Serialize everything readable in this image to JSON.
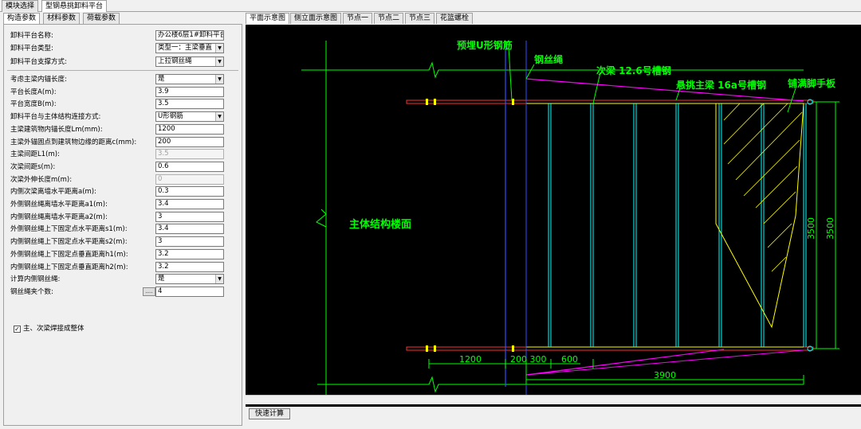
{
  "top_tabs": [
    "模块选择",
    "型钢悬挑卸料平台"
  ],
  "sub_tabs": [
    "构造参数",
    "材料参数",
    "荷载参数"
  ],
  "form": {
    "platform_name_label": "卸料平台名称:",
    "platform_name_value": "办公楼6层1#卸料平台",
    "platform_type_label": "卸料平台类型:",
    "platform_type_value": "类型一：主梁垂直",
    "support_label": "卸料平台支撑方式:",
    "support_value": "上拉钢丝绳",
    "rows": [
      {
        "label": "考虑主梁内锚长度:",
        "value": "是",
        "kind": "select"
      },
      {
        "label": "平台长度A(m):",
        "value": "3.9",
        "kind": "input"
      },
      {
        "label": "平台宽度B(m):",
        "value": "3.5",
        "kind": "input"
      },
      {
        "label": "卸料平台与主体结构连接方式:",
        "value": "U形钢筋",
        "kind": "select"
      },
      {
        "label": "主梁建筑物内锚长度Lm(mm):",
        "value": "1200",
        "kind": "input"
      },
      {
        "label": "主梁外锚固点到建筑物边缘的距离c(mm):",
        "value": "200",
        "kind": "input"
      },
      {
        "label": "主梁间距L1(m):",
        "value": "3.5",
        "kind": "disabled"
      },
      {
        "label": "次梁间距s(m):",
        "value": "0.6",
        "kind": "input"
      },
      {
        "label": "次梁外伸长度m(m):",
        "value": "0",
        "kind": "disabled"
      },
      {
        "label": "内侧次梁离墙水平距离a(m):",
        "value": "0.3",
        "kind": "input"
      },
      {
        "label": "外侧钢丝绳离墙水平距离a1(m):",
        "value": "3.4",
        "kind": "input"
      },
      {
        "label": "内侧钢丝绳离墙水平距离a2(m):",
        "value": "3",
        "kind": "input"
      },
      {
        "label": "外侧钢丝绳上下固定点水平距离s1(m):",
        "value": "3.4",
        "kind": "input"
      },
      {
        "label": "内侧钢丝绳上下固定点水平距离s2(m):",
        "value": "3",
        "kind": "input"
      },
      {
        "label": "外侧钢丝绳上下固定点垂直距离h1(m):",
        "value": "3.2",
        "kind": "input"
      },
      {
        "label": "内侧钢丝绳上下固定点垂直距离h2(m):",
        "value": "3.2",
        "kind": "input"
      },
      {
        "label": "计算内侧钢丝绳:",
        "value": "是",
        "kind": "select"
      },
      {
        "label": "钢丝绳夹个数:",
        "value": "4",
        "kind": "input"
      }
    ],
    "checkbox_label": "主、次梁焊接成整体",
    "checkbox_mark": "✓",
    "dropdown_glyph": "▼",
    "dots_glyph": "....."
  },
  "view_tabs": [
    "平面示意图",
    "侧立面示意图",
    "节点一",
    "节点二",
    "节点三",
    "花篮螺栓"
  ],
  "drawing": {
    "labels": {
      "embed": "预埋U形钢筋",
      "wire": "钢丝绳",
      "secondary": "次梁 12.6号槽钢",
      "main": "悬挑主梁 16a号槽钢",
      "board": "铺满脚手板",
      "structure": "主体结构楼面"
    },
    "dims": {
      "d1200": "1200",
      "d200300": "200 300",
      "d600": "600",
      "d3900": "3900",
      "d3500a": "3500",
      "d3500b": "3500"
    }
  },
  "calc_button": "快速计算",
  "colors": {
    "canvas": "#000000",
    "label_green": "#00ff00",
    "magenta": "#ff00ff",
    "cyan": "#00ffff",
    "yellow": "#ffff00",
    "red": "#ff3030"
  }
}
